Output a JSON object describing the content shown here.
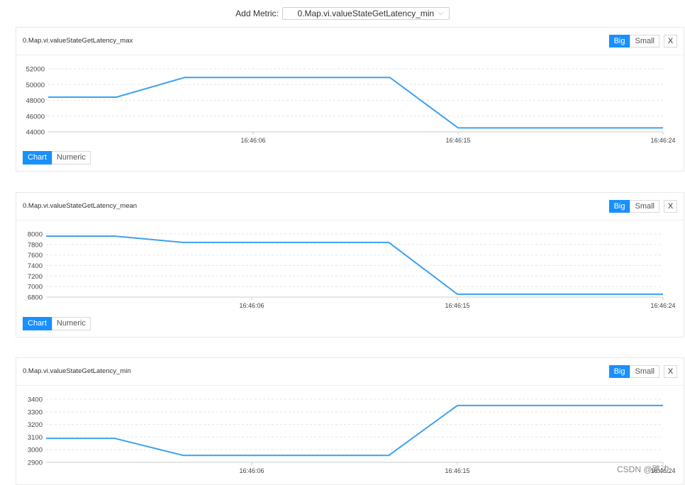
{
  "toolbar": {
    "add_metric_label": "Add Metric:",
    "selected_metric": "0.Map.vi.valueStateGetLatency_min"
  },
  "panels": [
    {
      "title": "0.Map.vi.valueStateGetLatency_max",
      "big_label": "Big",
      "small_label": "Small",
      "close_label": "X",
      "chart_label": "Chart",
      "numeric_label": "Numeric"
    },
    {
      "title": "0.Map.vi.valueStateGetLatency_mean",
      "big_label": "Big",
      "small_label": "Small",
      "close_label": "X",
      "chart_label": "Chart",
      "numeric_label": "Numeric"
    },
    {
      "title": "0.Map.vi.valueStateGetLatency_min",
      "big_label": "Big",
      "small_label": "Small",
      "close_label": "X"
    }
  ],
  "chart_data": [
    {
      "type": "line",
      "x": [
        "",
        "",
        "",
        "16:46:06",
        "",
        "",
        "16:46:15",
        "",
        "",
        "16:46:24"
      ],
      "ylim": [
        44000,
        52000
      ],
      "yticks": [
        44000,
        46000,
        48000,
        50000,
        52000
      ],
      "series": [
        {
          "values": [
            48400,
            48400,
            50900,
            50900,
            50900,
            50900,
            44500,
            44500,
            44500,
            44500
          ]
        }
      ],
      "color": "#3ba1f0"
    },
    {
      "type": "line",
      "x": [
        "",
        "",
        "",
        "16:46:06",
        "",
        "",
        "16:46:15",
        "",
        "",
        "16:46:24"
      ],
      "ylim": [
        6800,
        8000
      ],
      "yticks": [
        6800,
        7000,
        7200,
        7400,
        7600,
        7800,
        8000
      ],
      "series": [
        {
          "values": [
            7960,
            7960,
            7840,
            7840,
            7840,
            7840,
            6855,
            6855,
            6855,
            6855
          ]
        }
      ],
      "color": "#3ba1f0"
    },
    {
      "type": "line",
      "x": [
        "",
        "",
        "",
        "16:46:06",
        "",
        "",
        "16:46:15",
        "",
        "",
        "16:46:24"
      ],
      "ylim": [
        2900,
        3400
      ],
      "yticks": [
        2900,
        3000,
        3100,
        3200,
        3300,
        3400
      ],
      "series": [
        {
          "values": [
            3090,
            3090,
            2955,
            2955,
            2955,
            2955,
            3350,
            3350,
            3350,
            3350
          ]
        }
      ],
      "color": "#3ba1f0"
    }
  ],
  "watermark": "CSDN @路边"
}
